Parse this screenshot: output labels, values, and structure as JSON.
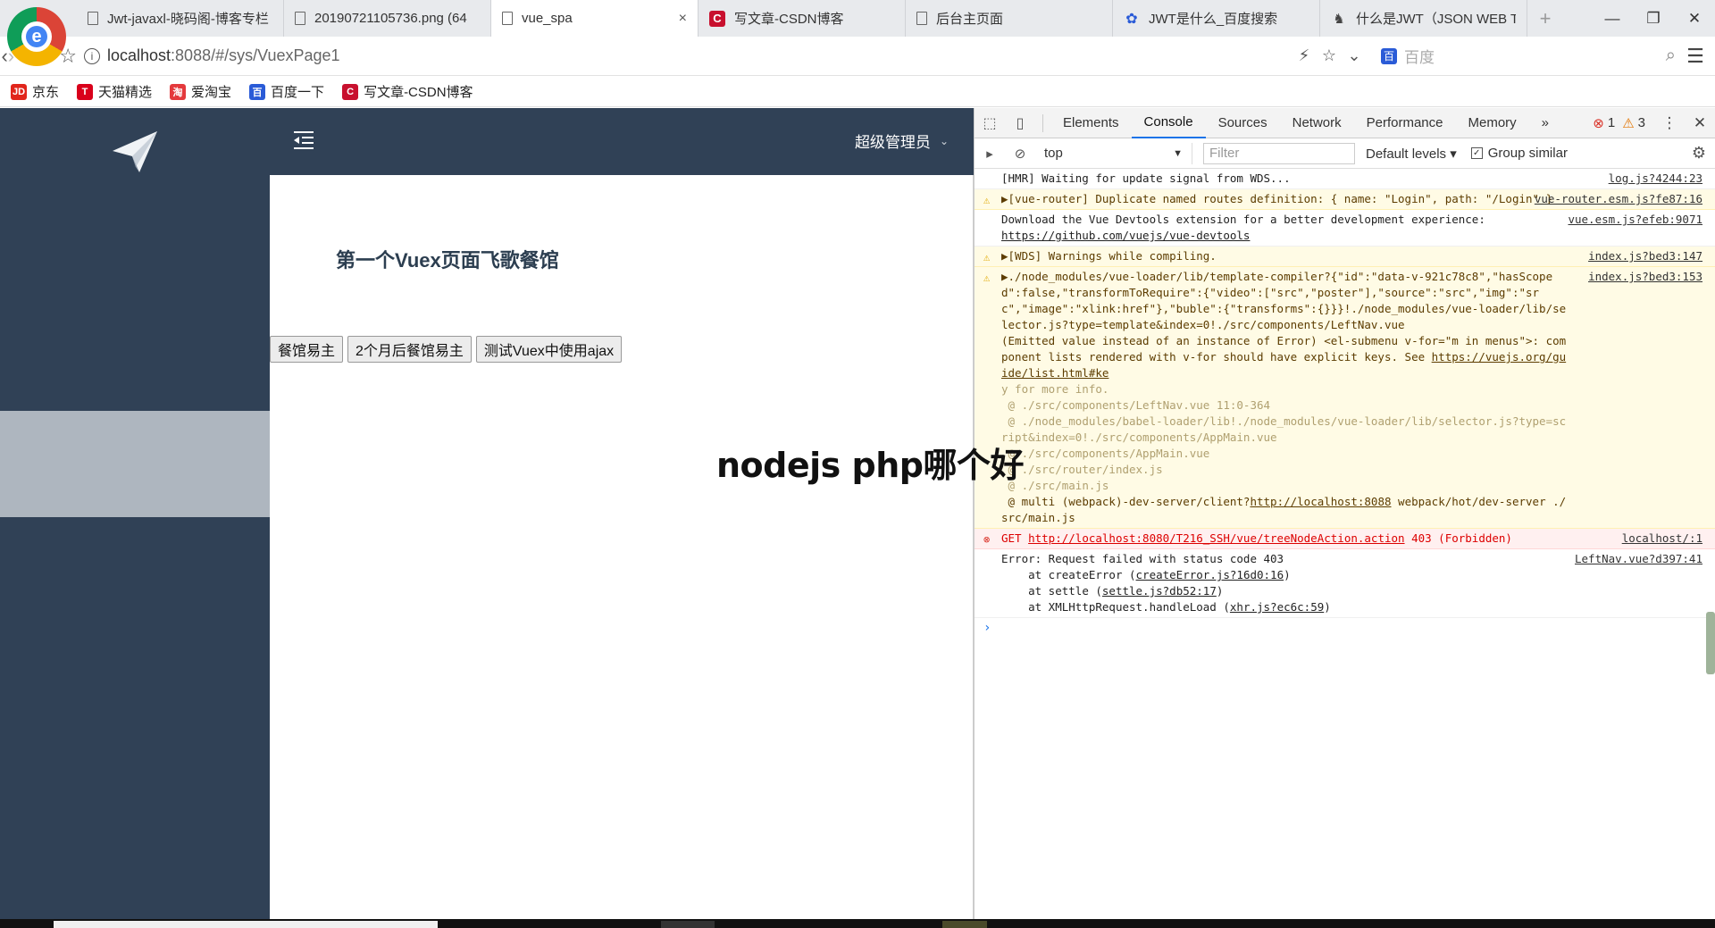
{
  "browser": {
    "tabs": [
      {
        "label": "Jwt-javaxl-晓码阁-博客专栏",
        "icon": "doc-icon",
        "active": false
      },
      {
        "label": "20190721105736.png (64",
        "icon": "doc-icon",
        "active": false
      },
      {
        "label": "vue_spa",
        "icon": "doc-icon",
        "active": true,
        "close": "×"
      },
      {
        "label": "写文章-CSDN博客",
        "icon": "csdn-icon",
        "active": false
      },
      {
        "label": "后台主页面",
        "icon": "doc-icon",
        "active": false
      },
      {
        "label": "JWT是什么_百度搜索",
        "icon": "paw-icon",
        "active": false
      },
      {
        "label": "什么是JWT（JSON WEB T",
        "icon": "misc-icon",
        "active": false
      }
    ],
    "new_tab": "+",
    "url_host": "localhost",
    "url_path": ":8088/#/sys/VuexPage1",
    "search_placeholder": "百度",
    "bookmarks": [
      {
        "label": "京东",
        "icon": "jd-icon",
        "badge": "JD",
        "color": "#e1251b"
      },
      {
        "label": "天猫精选",
        "icon": "tmall-icon",
        "badge": "T",
        "color": "#d9001b"
      },
      {
        "label": "爱淘宝",
        "icon": "taobao-icon",
        "badge": "淘",
        "color": "#e4393c"
      },
      {
        "label": "百度一下",
        "icon": "baidu-icon",
        "badge": "百",
        "color": "#2a5bd7"
      },
      {
        "label": "写文章-CSDN博客",
        "icon": "csdn-icon",
        "badge": "C",
        "color": "#c8102e"
      }
    ]
  },
  "app": {
    "user_menu": "超级管理员",
    "page_title": "第一个Vuex页面飞歌餐馆",
    "buttons": [
      "餐馆易主",
      "2个月后餐馆易主",
      "测试Vuex中使用ajax"
    ],
    "colors": {
      "sidebar": "#304156",
      "highlight": "#aeb6bf"
    }
  },
  "overlay": "nodejs php哪个好",
  "devtools": {
    "tabs": [
      "Elements",
      "Console",
      "Sources",
      "Network",
      "Performance",
      "Memory"
    ],
    "more": "»",
    "active_tab": "Console",
    "error_count": "1",
    "warning_count": "3",
    "context": "top",
    "filter_placeholder": "Filter",
    "levels": "Default levels",
    "group_similar": "Group similar",
    "messages": [
      {
        "type": "log",
        "text": "[HMR] Waiting for update signal from WDS...",
        "src": "log.js?4244:23"
      },
      {
        "type": "warn",
        "text": "▶[vue-router] Duplicate named routes definition: { name: \"Login\", path: \"/Login\" }",
        "src": "vue-router.esm.js?fe87:16"
      },
      {
        "type": "log",
        "text": "Download the Vue Devtools extension for a better development experience:",
        "link": "https://github.com/vuejs/vue-devtools",
        "src": "vue.esm.js?efeb:9071"
      },
      {
        "type": "warn",
        "text": "▶[WDS] Warnings while compiling.",
        "src": "index.js?bed3:147"
      },
      {
        "type": "warn",
        "text": "▶./node_modules/vue-loader/lib/template-compiler?{\"id\":\"data-v-921c78c8\",\"hasScoped\":false,\"transformToRequire\":{\"video\":[\"src\",\"poster\"],\"source\":\"src\",\"img\":\"src\",\"image\":\"xlink:href\"},\"buble\":{\"transforms\":{}}}!./node_modules/vue-loader/lib/selector.js?type=template&index=0!./src/components/LeftNav.vue\n(Emitted value instead of an instance of Error) <el-submenu v-for=\"m in menus\">: component lists rendered with v-for should have explicit keys. See ",
        "link": "https://vuejs.org/guide/list.html#ke",
        "faded": "y for more info.\n @ ./src/components/LeftNav.vue 11:0-364\n @ ./node_modules/babel-loader/lib!./node_modules/vue-loader/lib/selector.js?type=script&index=0!./src/components/AppMain.vue\n @ ./src/components/AppMain.vue\n @ ./src/router/index.js\n @ ./src/main.js",
        "tail": " @ multi (webpack)-dev-server/client?",
        "tail_link": "http://localhost:8088",
        "tail2": " webpack/hot/dev-server ./src/main.js",
        "src": "index.js?bed3:153"
      },
      {
        "type": "error",
        "text": "GET ",
        "link": "http://localhost:8080/T216_SSH/vue/treeNodeAction.action",
        "after": " 403 (Forbidden)",
        "src": "localhost/:1"
      },
      {
        "type": "log",
        "text": "Error: Request failed with status code 403\n    at createError (",
        "l1": "createError.js?16d0:16",
        "t2": ")\n    at settle (",
        "l2": "settle.js?db52:17",
        "t3": ")\n    at XMLHttpRequest.handleLoad (",
        "l3": "xhr.js?ec6c:59",
        "t4": ")",
        "src": "LeftNav.vue?d397:41"
      }
    ],
    "prompt": "›"
  }
}
